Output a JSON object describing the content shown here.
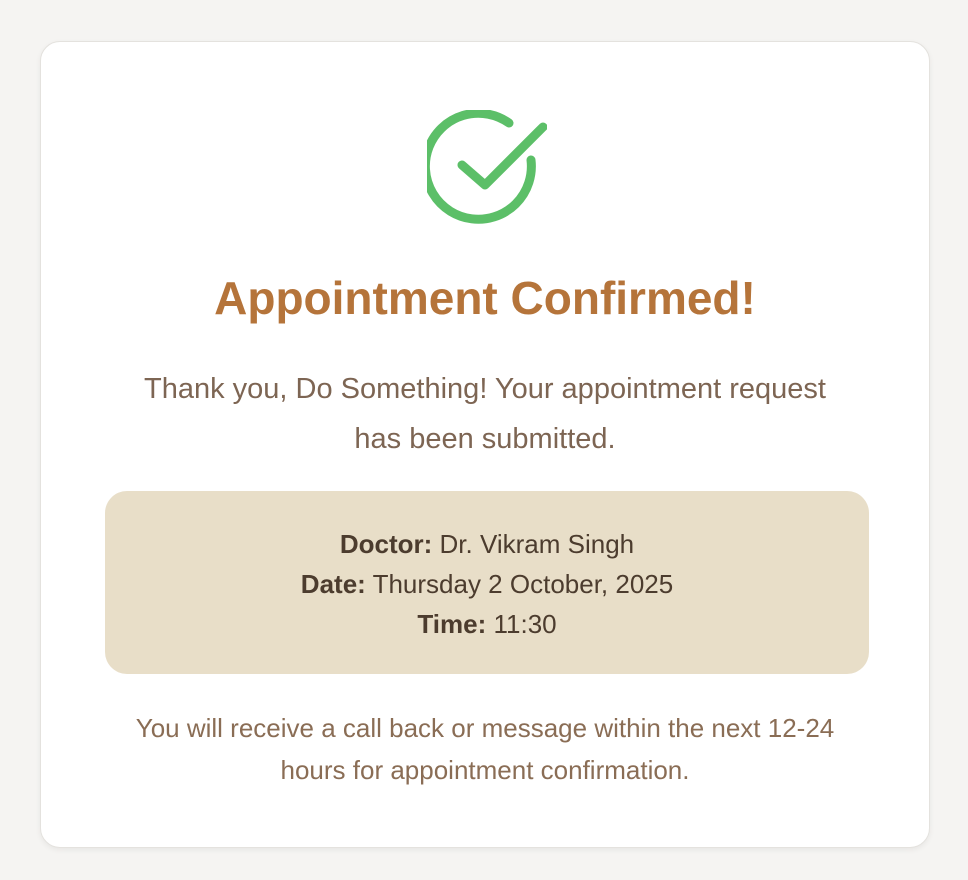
{
  "confirmation": {
    "title": "Appointment Confirmed!",
    "message": "Thank you, Do Something! Your appointment request has been submitted.",
    "details": {
      "doctor_label": "Doctor:",
      "doctor_value": "Dr. Vikram Singh",
      "date_label": "Date:",
      "date_value": "Thursday 2 October, 2025",
      "time_label": "Time:",
      "time_value": "11:30"
    },
    "note": "You will receive a call back or message within the next 12-24 hours for appointment confirmation.",
    "icon": "check-circle-icon"
  },
  "colors": {
    "accent": "#b5743a",
    "success": "#5cbf68",
    "details_bg": "#e8dec8",
    "text_muted": "#8a6d55"
  }
}
